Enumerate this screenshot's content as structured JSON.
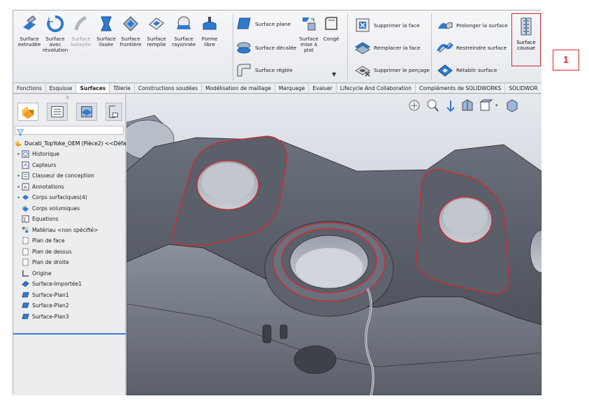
{
  "ribbon": {
    "buttons": [
      {
        "label": "Surface extrudée",
        "icon": "extrude-surface-icon"
      },
      {
        "label": "Surface avec révolution",
        "icon": "revolve-surface-icon"
      },
      {
        "label": "Surface balayée",
        "icon": "sweep-surface-icon",
        "disabled": true
      },
      {
        "label": "Surface lissée",
        "icon": "loft-surface-icon"
      },
      {
        "label": "Surface frontière",
        "icon": "boundary-surface-icon"
      },
      {
        "label": "Surface remplie",
        "icon": "filled-surface-icon"
      },
      {
        "label": "Surface rayonnée",
        "icon": "radiate-surface-icon"
      },
      {
        "label": "Forme libre",
        "icon": "freeform-icon"
      }
    ],
    "col2": [
      {
        "label": "Surface plane",
        "icon": "planar-surface-icon"
      },
      {
        "label": "Surface décalée",
        "icon": "offset-surface-icon"
      },
      {
        "label": "Surface réglée",
        "icon": "ruled-surface-icon"
      }
    ],
    "mid_buttons": [
      {
        "label": "Surface mise à plat",
        "icon": "flatten-surface-icon"
      },
      {
        "label": "Congé",
        "icon": "fillet-icon"
      }
    ],
    "col3": [
      {
        "label": "Supprimer la face",
        "icon": "delete-face-icon"
      },
      {
        "label": "Remplacer la face",
        "icon": "replace-face-icon"
      },
      {
        "label": "Supprimer le perçage",
        "icon": "delete-hole-icon"
      }
    ],
    "col4": [
      {
        "label": "Prolonger la surface",
        "icon": "extend-surface-icon"
      },
      {
        "label": "Restreindre surface",
        "icon": "trim-surface-icon"
      },
      {
        "label": "Rétablir surface",
        "icon": "untrim-surface-icon"
      }
    ],
    "knit": {
      "label": "Surface cousue",
      "icon": "knit-surface-icon"
    }
  },
  "tabs": [
    "Fonctions",
    "Esquisse",
    "Surfaces",
    "Tôlerie",
    "Constructions soudées",
    "Modélisation de maillage",
    "Marquage",
    "Evaluer",
    "Lifecycle And Collaboration",
    "Compléments de SOLIDWORKS",
    "SOLIDWOR"
  ],
  "active_tab": "Surfaces",
  "tree": {
    "root": "Ducati_TopYoke_OEM (Pièce2) <<Défa",
    "items": [
      {
        "label": "Historique",
        "expandable": true
      },
      {
        "label": "Capteurs",
        "expandable": false
      },
      {
        "label": "Classeur de conception",
        "expandable": true
      },
      {
        "label": "Annotations",
        "expandable": true
      },
      {
        "label": "Corps surfaciques(4)",
        "expandable": true
      },
      {
        "label": "Corps volumiques",
        "expandable": false
      },
      {
        "label": "Equations",
        "expandable": false
      },
      {
        "label": "Matériau <non spécifié>",
        "expandable": false
      },
      {
        "label": "Plan de face",
        "expandable": false
      },
      {
        "label": "Plan de dessus",
        "expandable": false
      },
      {
        "label": "Plan de droite",
        "expandable": false
      },
      {
        "label": "Origine",
        "expandable": false
      },
      {
        "label": "Surface-Importée1",
        "expandable": false
      },
      {
        "label": "Surface-Plan1",
        "expandable": false
      },
      {
        "label": "Surface-Plan2",
        "expandable": false
      },
      {
        "label": "Surface-Plan3",
        "expandable": false
      }
    ]
  },
  "annotation_label": "1",
  "colors": {
    "accent_red": "#d9262d",
    "icon_blue": "#2f7ad0",
    "part_gray": "#5f6470"
  }
}
